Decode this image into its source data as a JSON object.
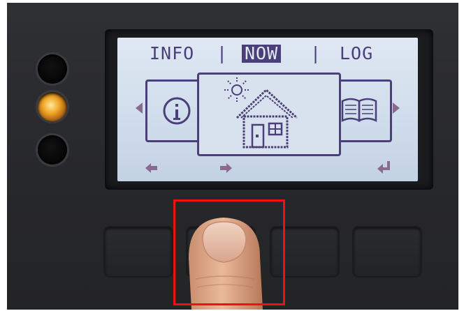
{
  "screen": {
    "menu": {
      "items": [
        "INFO",
        "NOW",
        "LOG"
      ],
      "separator": "|",
      "selected": "NOW"
    },
    "cards": {
      "left_icon": "info-icon",
      "center_icon": "house-with-sun-icon",
      "right_icon": "log-book-icon"
    },
    "softkeys": {
      "key1_icon": "arrow-left-icon",
      "key2_icon": "arrow-right-icon",
      "key4_icon": "enter-return-icon"
    }
  },
  "hardware": {
    "leds": [
      "off",
      "amber-on",
      "off"
    ],
    "buttons": 4,
    "pressed_button": 2
  },
  "annotation": {
    "color": "#ee1111"
  },
  "colors": {
    "lcd_background": "#d4dfec",
    "lcd_ink": "#4a3f78",
    "device_body": "#2b2c2f"
  }
}
